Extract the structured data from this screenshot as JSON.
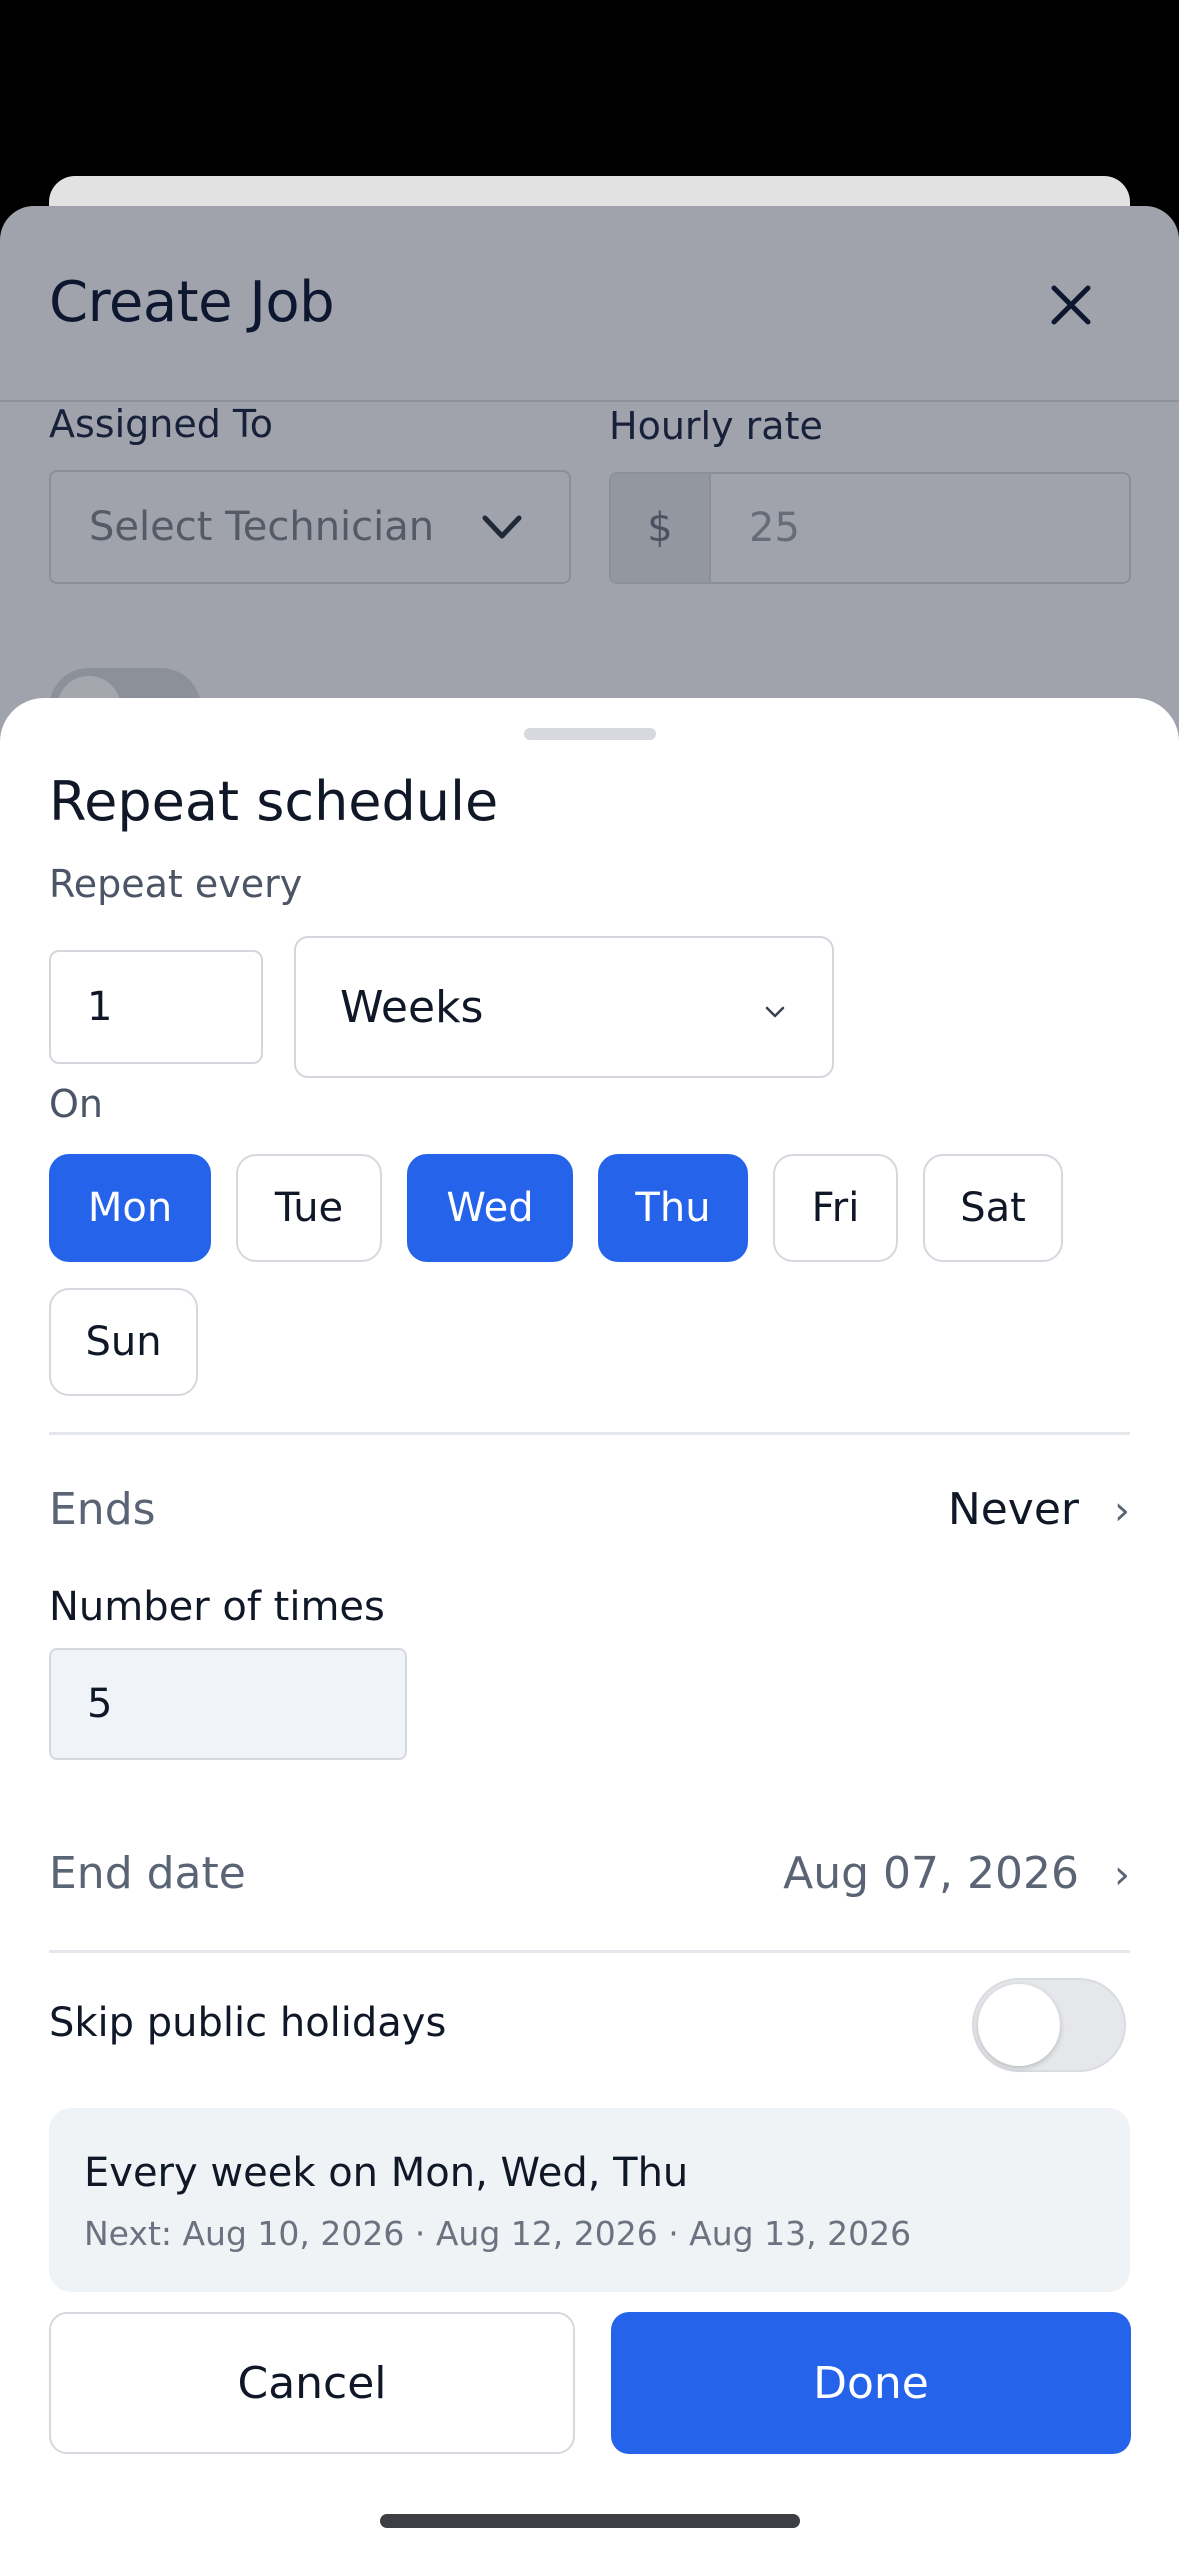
{
  "background_modal": {
    "title": "Create Job",
    "assigned_to_label": "Assigned To",
    "technician_placeholder": "Select Technician",
    "hourly_rate_label": "Hourly rate",
    "currency_symbol": "$",
    "hourly_rate_value": "25"
  },
  "sheet": {
    "title": "Repeat schedule",
    "repeat_every_label": "Repeat every",
    "interval_value": "1",
    "interval_unit": "Weeks",
    "on_label": "On",
    "days": [
      {
        "label": "Mon",
        "selected": true
      },
      {
        "label": "Tue",
        "selected": false
      },
      {
        "label": "Wed",
        "selected": true
      },
      {
        "label": "Thu",
        "selected": true
      },
      {
        "label": "Fri",
        "selected": false
      },
      {
        "label": "Sat",
        "selected": false
      },
      {
        "label": "Sun",
        "selected": false
      }
    ],
    "ends_label": "Ends",
    "ends_value": "Never",
    "number_of_times_label": "Number of times",
    "number_of_times_value": "5",
    "end_date_label": "End date",
    "end_date_value": "Aug 07, 2026",
    "skip_holidays_label": "Skip public holidays",
    "skip_holidays_enabled": false,
    "summary_main": "Every week on Mon, Wed, Thu",
    "summary_next": "Next: Aug 10, 2026 · Aug 12, 2026 · Aug 13, 2026",
    "cancel_label": "Cancel",
    "done_label": "Done"
  },
  "colors": {
    "accent": "#2563eb",
    "overlay": "#a0a3ac"
  }
}
